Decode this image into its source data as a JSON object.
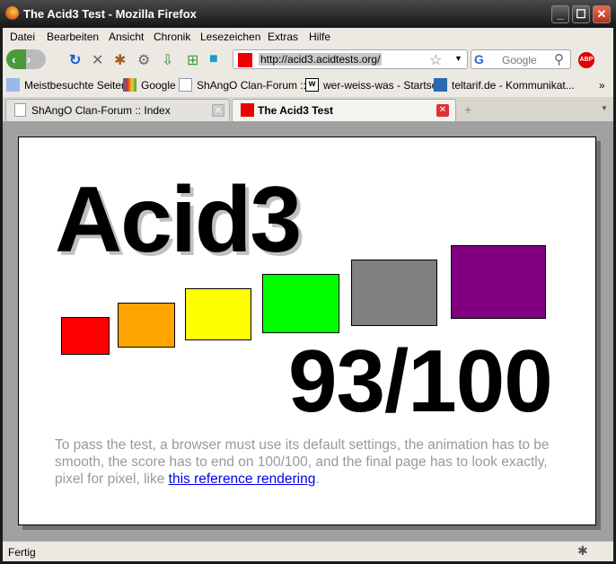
{
  "window": {
    "title": "The Acid3 Test - Mozilla Firefox",
    "minimize": "_",
    "maximize": "☐",
    "close": "✕"
  },
  "menu": [
    "Datei",
    "Bearbeiten",
    "Ansicht",
    "Chronik",
    "Lesezeichen",
    "Extras",
    "Hilfe"
  ],
  "navbar": {
    "url": "http://acid3.acidtests.org/",
    "search_placeholder": "Google"
  },
  "bookmarks": [
    "Meistbesuchte Seiten",
    "Google",
    "ShAngO Clan-Forum :: ...",
    "wer-weiss-was - Startse...",
    "teltarif.de - Kommunikat..."
  ],
  "bookmarks_more": "»",
  "tabs": [
    {
      "label": "ShAngO Clan-Forum :: Index",
      "selected": false
    },
    {
      "label": "The Acid3 Test",
      "selected": true
    }
  ],
  "page": {
    "heading": "Acid3",
    "score": "93/100",
    "squares": [
      "#ff0000",
      "#ffa500",
      "#ffff00",
      "#00ff00",
      "#808080",
      "#800080"
    ],
    "text": "To pass the test, a browser must use its default settings, the animation has to be smooth, the score has to end on 100/100, and the final page has to look exactly, pixel for pixel, like ",
    "link": "this reference rendering",
    "text_end": "."
  },
  "status": {
    "text": "Fertig"
  }
}
